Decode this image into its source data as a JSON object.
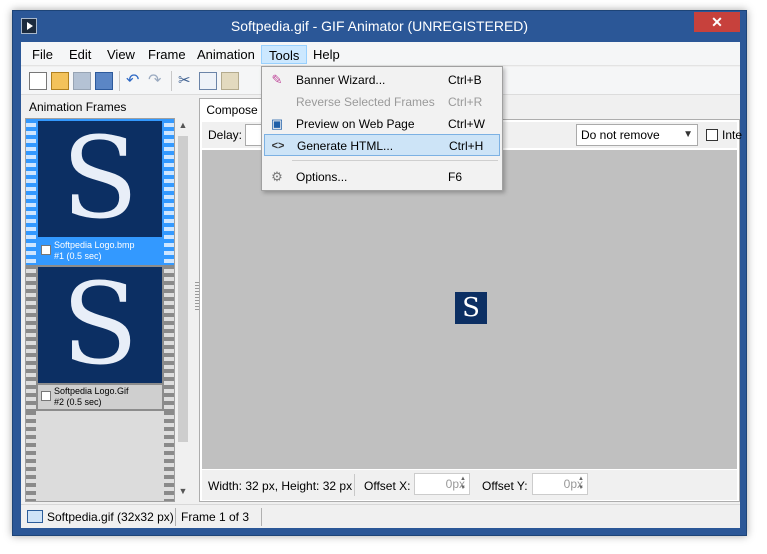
{
  "window": {
    "title": "Softpedia.gif - GIF Animator (UNREGISTERED)",
    "close_glyph": "✕"
  },
  "menu": {
    "items": [
      "File",
      "Edit",
      "View",
      "Frame",
      "Animation",
      "Tools",
      "Help"
    ],
    "active": "Tools"
  },
  "toolbar": {
    "icons": [
      "new-icon",
      "open-icon",
      "save-icon",
      "properties-icon",
      "undo-icon",
      "redo-icon",
      "cut-icon",
      "copy-icon",
      "paste-icon"
    ]
  },
  "frames_panel": {
    "title": "Animation Frames",
    "frames": [
      {
        "name": "Softpedia Logo.bmp",
        "info": "#1 (0.5 sec)",
        "glyph": "S",
        "selected": true
      },
      {
        "name": "Softpedia Logo.Gif",
        "info": "#2 (0.5 sec)",
        "glyph": "S",
        "selected": false
      }
    ],
    "scroll_up": "▲",
    "scroll_down": "▼"
  },
  "compose": {
    "tab_label": "Compose",
    "delay_label": "Delay:",
    "delay_value": "",
    "disposal_value": "Do not remove",
    "disposal_arrow": "▼",
    "interlaced_label": "Inte",
    "canvas_glyph": "S",
    "canvas_color": "#c0c0c0"
  },
  "info_bar": {
    "size_text": "Width: 32 px, Height: 32 px",
    "offset_x_label": "Offset X:",
    "offset_x_value": "0px",
    "offset_y_label": "Offset Y:",
    "offset_y_value": "0px",
    "spin_up": "▲",
    "spin_down": "▼"
  },
  "status": {
    "file": "Softpedia.gif (32x32 px)",
    "frame": "Frame 1 of 3"
  },
  "tools_menu": {
    "items": [
      {
        "label": "Banner Wizard...",
        "shortcut": "Ctrl+B",
        "icon": "wand-icon",
        "glyph": "✎",
        "enabled": true,
        "hover": false
      },
      {
        "label": "Reverse Selected Frames",
        "shortcut": "Ctrl+R",
        "icon": "reverse-icon",
        "glyph": "",
        "enabled": false,
        "hover": false
      },
      {
        "label": "Preview on Web Page",
        "shortcut": "Ctrl+W",
        "icon": "web-preview-icon",
        "glyph": "▣",
        "enabled": true,
        "hover": false
      },
      {
        "label": "Generate HTML...",
        "shortcut": "Ctrl+H",
        "icon": "html-code-icon",
        "glyph": "<>",
        "enabled": true,
        "hover": true
      },
      {
        "label": "Options...",
        "shortcut": "F6",
        "icon": "gear-icon",
        "glyph": "⚙",
        "enabled": true,
        "hover": false
      }
    ]
  },
  "colors": {
    "title_bar": "#2b5797",
    "selection": "#3399ff",
    "logo_bg": "#0c2f63",
    "close_button": "#c7413c"
  }
}
